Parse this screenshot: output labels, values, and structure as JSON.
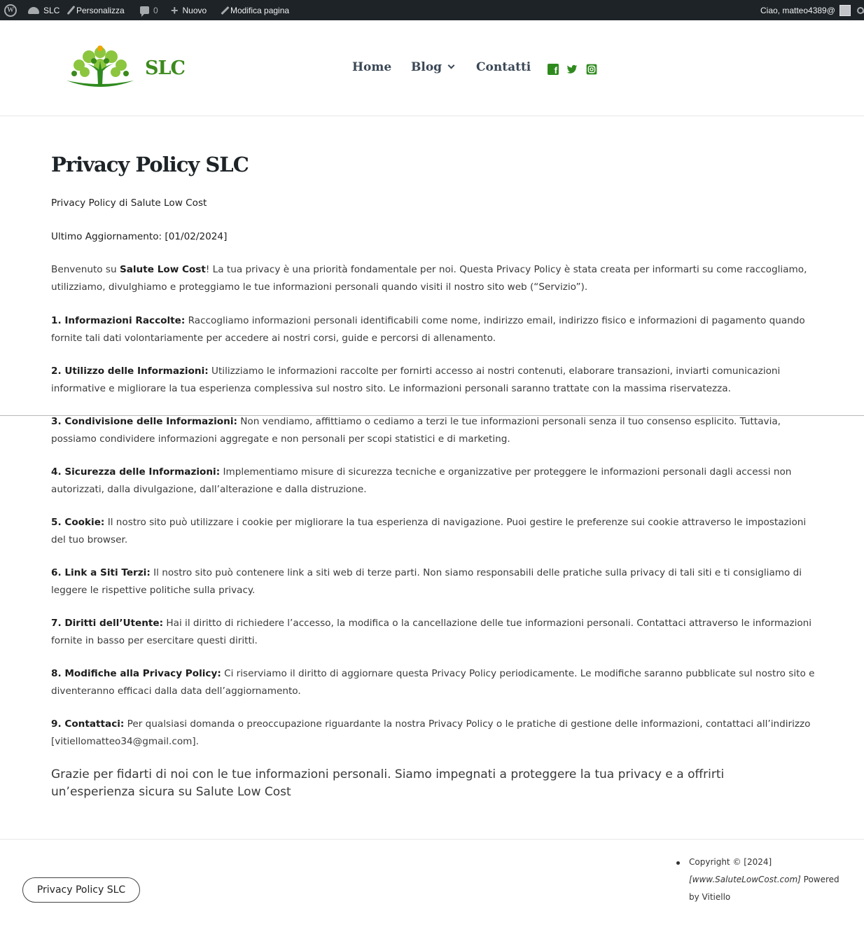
{
  "admin_bar": {
    "site": "SLC",
    "customize": "Personalizza",
    "comments_count": "0",
    "new": "Nuovo",
    "edit_page": "Modifica pagina",
    "greeting": "Ciao, matteo4389@"
  },
  "header": {
    "site_title": "SLC",
    "nav": [
      "Home",
      "Blog",
      "Contatti"
    ],
    "social_icons": [
      "facebook-icon",
      "twitter-icon",
      "instagram-icon"
    ],
    "brand_color": "#2f8a1e"
  },
  "page": {
    "title": "Privacy Policy SLC",
    "subtitle": "Privacy Policy di Salute Low Cost",
    "updated": "Ultimo Aggiornamento: [01/02/2024]",
    "intro_pre": "Benvenuto su ",
    "intro_bold": "Salute Low Cost",
    "intro_post": "! La tua privacy è una priorità fondamentale per noi. Questa Privacy Policy è stata creata per informarti su come raccogliamo, utilizziamo, divulghiamo e proteggiamo le tue informazioni personali quando visiti il nostro sito web (“Servizio”).",
    "sections": [
      {
        "heading": "1. Informazioni Raccolte:",
        "text": " Raccogliamo informazioni personali identificabili come nome, indirizzo email, indirizzo fisico e informazioni di pagamento quando fornite tali dati volontariamente per accedere ai nostri corsi, guide e percorsi di allenamento."
      },
      {
        "heading": "2. Utilizzo delle Informazioni:",
        "text": " Utilizziamo le informazioni raccolte per fornirti accesso ai nostri contenuti, elaborare transazioni, inviarti comunicazioni informative e migliorare la tua esperienza complessiva sul nostro sito. Le informazioni personali saranno trattate con la massima riservatezza."
      },
      {
        "heading": "3. Condivisione delle Informazioni:",
        "text": " Non vendiamo, affittiamo o cediamo a terzi le tue informazioni personali senza il tuo consenso esplicito. Tuttavia, possiamo condividere informazioni aggregate e non personali per scopi statistici e di marketing."
      },
      {
        "heading": "4. Sicurezza delle Informazioni:",
        "text": " Implementiamo misure di sicurezza tecniche e organizzative per proteggere le informazioni personali dagli accessi non autorizzati, dalla divulgazione, dall’alterazione e dalla distruzione."
      },
      {
        "heading": "5. Cookie:",
        "text": " Il nostro sito può utilizzare i cookie per migliorare la tua esperienza di navigazione. Puoi gestire le preferenze sui cookie attraverso le impostazioni del tuo browser."
      },
      {
        "heading": "6. Link a Siti Terzi:",
        "text": " Il nostro sito può contenere link a siti web di terze parti. Non siamo responsabili delle pratiche sulla privacy di tali siti e ti consigliamo di leggere le rispettive politiche sulla privacy."
      },
      {
        "heading": "7. Diritti dell’Utente:",
        "text": " Hai il diritto di richiedere l’accesso, la modifica o la cancellazione delle tue informazioni personali. Contattaci attraverso le informazioni fornite in basso per esercitare questi diritti."
      },
      {
        "heading": "8. Modifiche alla Privacy Policy:",
        "text": " Ci riserviamo il diritto di aggiornare questa Privacy Policy periodicamente. Le modifiche saranno pubblicate sul nostro sito e diventeranno efficaci dalla data dell’aggiornamento."
      },
      {
        "heading": "9. Contattaci:",
        "text": " Per qualsiasi domanda o preoccupazione riguardante la nostra Privacy Policy o le pratiche di gestione delle informazioni, contattaci all’indirizzo [vitiellomatteo34@gmail.com]."
      }
    ],
    "closing": "Grazie per fidarti di noi con le tue informazioni personali. Siamo impegnati a proteggere la tua privacy e a offrirti un’esperienza sicura su Salute Low Cost"
  },
  "footer": {
    "button": "Privacy Policy SLC",
    "copyright": "Copyright © [2024]",
    "site_url": "[www.SaluteLowCost.com]",
    "powered": " Powered by Vitiello"
  }
}
